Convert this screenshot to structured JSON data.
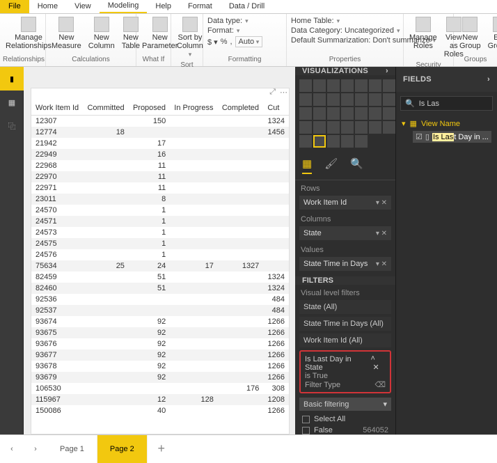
{
  "tabs": [
    "File",
    "Home",
    "View",
    "Modeling",
    "Help",
    "Format",
    "Data / Drill"
  ],
  "ribbon": {
    "manage": {
      "btn": "Manage\nRelationships",
      "label": "Relationships"
    },
    "calc": {
      "b1": "New\nMeasure",
      "b2": "New\nColumn",
      "b3": "New\nTable",
      "label": "Calculations"
    },
    "whatif": {
      "btn": "New\nParameter",
      "label": "What If"
    },
    "sort": {
      "btn": "Sort by\nColumn",
      "label": "Sort"
    },
    "fmt": {
      "r1": "Data type:",
      "r2": "Format:",
      "auto": "Auto",
      "label": "Formatting"
    },
    "props": {
      "r1": "Home Table:",
      "r2": "Data Category: Uncategorized",
      "r3": "Default Summarization: Don't summarize",
      "label": "Properties"
    },
    "sec": {
      "b1": "Manage\nRoles",
      "b2": "View as\nRoles",
      "label": "Security"
    },
    "grp": {
      "b1": "New\nGroup",
      "b2": "Edit\nGroups",
      "label": "Groups"
    }
  },
  "table": {
    "cols": [
      "Work Item Id",
      "Committed",
      "Proposed",
      "In Progress",
      "Completed",
      "Cut"
    ],
    "rows": [
      [
        "12307",
        "",
        "150",
        "",
        "",
        "1324"
      ],
      [
        "12774",
        "18",
        "",
        "",
        "",
        "1456"
      ],
      [
        "21942",
        "",
        "17",
        "",
        "",
        ""
      ],
      [
        "22949",
        "",
        "16",
        "",
        "",
        ""
      ],
      [
        "22968",
        "",
        "11",
        "",
        "",
        ""
      ],
      [
        "22970",
        "",
        "11",
        "",
        "",
        ""
      ],
      [
        "22971",
        "",
        "11",
        "",
        "",
        ""
      ],
      [
        "23011",
        "",
        "8",
        "",
        "",
        ""
      ],
      [
        "24570",
        "",
        "1",
        "",
        "",
        ""
      ],
      [
        "24571",
        "",
        "1",
        "",
        "",
        ""
      ],
      [
        "24573",
        "",
        "1",
        "",
        "",
        ""
      ],
      [
        "24575",
        "",
        "1",
        "",
        "",
        ""
      ],
      [
        "24576",
        "",
        "1",
        "",
        "",
        ""
      ],
      [
        "75634",
        "25",
        "24",
        "17",
        "1327",
        ""
      ],
      [
        "82459",
        "",
        "51",
        "",
        "",
        "1324"
      ],
      [
        "82460",
        "",
        "51",
        "",
        "",
        "1324"
      ],
      [
        "92536",
        "",
        "",
        "",
        "",
        "484"
      ],
      [
        "92537",
        "",
        "",
        "",
        "",
        "484"
      ],
      [
        "93674",
        "",
        "92",
        "",
        "",
        "1266"
      ],
      [
        "93675",
        "",
        "92",
        "",
        "",
        "1266"
      ],
      [
        "93676",
        "",
        "92",
        "",
        "",
        "1266"
      ],
      [
        "93677",
        "",
        "92",
        "",
        "",
        "1266"
      ],
      [
        "93678",
        "",
        "92",
        "",
        "",
        "1266"
      ],
      [
        "93679",
        "",
        "92",
        "",
        "",
        "1266"
      ],
      [
        "106530",
        "",
        "",
        "",
        "176",
        "308"
      ],
      [
        "115967",
        "",
        "12",
        "128",
        "",
        "1208"
      ],
      [
        "150086",
        "",
        "40",
        "",
        "",
        "1266"
      ]
    ]
  },
  "vis": {
    "hdr": "VISUALIZATIONS",
    "rows_lbl": "Rows",
    "rows_val": "Work Item Id",
    "cols_lbl": "Columns",
    "cols_val": "State",
    "vals_lbl": "Values",
    "vals_val": "State Time in Days",
    "filters_hdr": "FILTERS",
    "vlf": "Visual level filters",
    "f1": "State  (All)",
    "f2": "State Time in Days  (All)",
    "f3": "Work Item Id  (All)",
    "f4_name": "Is Last Day in State",
    "f4_sub1": "is True",
    "f4_sub2": "Filter Type",
    "dd": "Basic filtering",
    "c1": "Select All",
    "c2": "False",
    "c2_count": "564052"
  },
  "fields": {
    "hdr": "FIELDS",
    "search": "Is Las",
    "table": "View Name",
    "field_pre": "Is Las",
    "field_suf": "t Day in ..."
  },
  "pages": {
    "p1": "Page 1",
    "p2": "Page 2"
  }
}
